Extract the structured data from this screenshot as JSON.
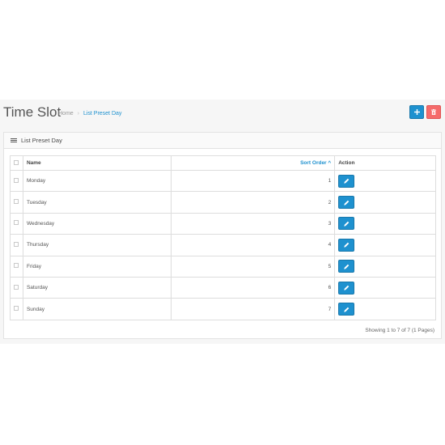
{
  "header": {
    "title": "Time Slot",
    "breadcrumb": {
      "home": "Home",
      "separator": "›",
      "current": "List Preset Day"
    },
    "add_icon": "plus-icon",
    "delete_icon": "trash-icon"
  },
  "panel": {
    "heading": "List Preset Day",
    "heading_icon": "list-icon"
  },
  "table": {
    "columns": {
      "name": "Name",
      "sort_order": "Sort Order",
      "sort_indicator": "^",
      "action": "Action"
    },
    "rows": [
      {
        "name": "Monday",
        "sort_order": "1"
      },
      {
        "name": "Tuesday",
        "sort_order": "2"
      },
      {
        "name": "Wednesday",
        "sort_order": "3"
      },
      {
        "name": "Thursday",
        "sort_order": "4"
      },
      {
        "name": "Friday",
        "sort_order": "5"
      },
      {
        "name": "Saturday",
        "sort_order": "6"
      },
      {
        "name": "Sunday",
        "sort_order": "7"
      }
    ],
    "edit_icon": "pencil-icon"
  },
  "footer": {
    "pagination_text": "Showing 1 to 7 of 7 (1 Pages)"
  },
  "colors": {
    "primary": "#1e91cf",
    "danger": "#f56b6b"
  }
}
